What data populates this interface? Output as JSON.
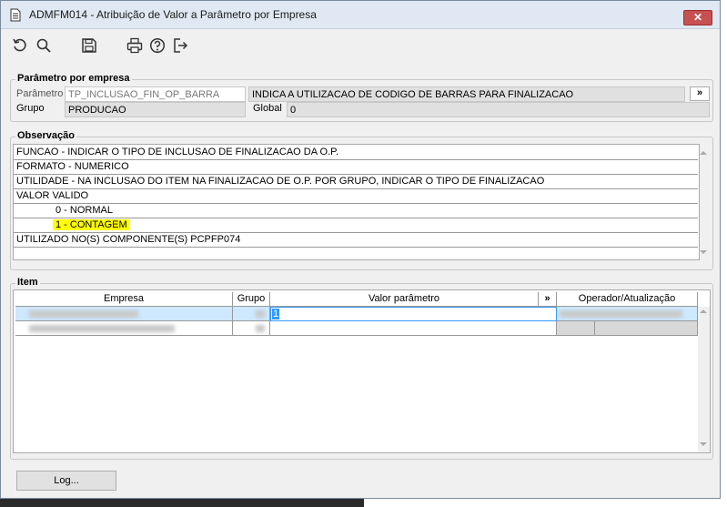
{
  "window": {
    "title": "ADMFM014 - Atribuição de Valor a Parâmetro por Empresa",
    "close_label": "✕"
  },
  "toolbar": {
    "icons": [
      "undo-icon",
      "search-icon",
      "save-icon",
      "print-icon",
      "help-icon",
      "exit-icon"
    ]
  },
  "parametro_por_empresa": {
    "legend": "Parâmetro por empresa",
    "parametro_label": "Parâmetro",
    "parametro_value": "TP_INCLUSAO_FIN_OP_BARRA",
    "parametro_desc": "INDICA  A UTILIZACAO DE CODIGO DE BARRAS PARA FINALIZACAO",
    "more_label": "»",
    "grupo_label": "Grupo",
    "grupo_value": "PRODUCAO",
    "global_label": "Global",
    "global_value": "0"
  },
  "observacao": {
    "legend": "Observação",
    "lines": [
      "FUNCAO - INDICAR O TIPO DE INCLUSAO DE FINALIZACAO DA O.P.",
      "FORMATO - NUMERICO",
      "UTILIDADE - NA INCLUSAO DO ITEM NA FINALIZACAO DE O.P. POR GRUPO, INDICAR O TIPO DE FINALIZACAO",
      "VALOR VALIDO",
      "0 - NORMAL",
      "1 - CONTAGEM",
      "UTILIZADO NO(S) COMPONENTE(S) PCPFP074"
    ]
  },
  "item": {
    "legend": "Item",
    "columns": {
      "empresa": "Empresa",
      "grupo": "Grupo",
      "valor": "Valor parâmetro",
      "more": "»",
      "operador": "Operador/Atualização"
    },
    "rows": [
      {
        "valor": "1"
      },
      {
        "valor": ""
      }
    ]
  },
  "footer": {
    "log_label": "Log..."
  }
}
